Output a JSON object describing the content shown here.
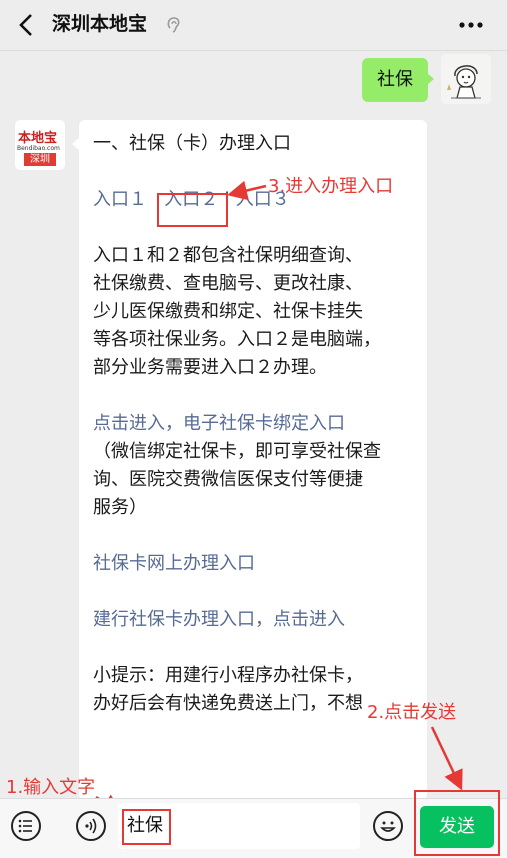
{
  "header": {
    "title": "深圳本地宝"
  },
  "outgoing": {
    "text": "社保"
  },
  "bot_avatar": {
    "logo": "本地宝",
    "site": "Bendibao.com",
    "city": "深圳"
  },
  "message": {
    "heading": "一、社保（卡）办理入口",
    "entry1": "入口１",
    "entry2": "入口２",
    "separator": "|",
    "entry3": "入口３",
    "desc_lines": [
      "入口１和２都包含社保明细查询、",
      "社保缴费、查电脑号、更改社康、",
      "少儿医保缴费和绑定、社保卡挂失",
      "等各项社保业务。入口２是电脑端，",
      "部分业务需要进入口２办理。"
    ],
    "ecard_link": "点击进入，电子社保卡绑定入口",
    "ecard_note_lines": [
      "（微信绑定社保卡，即可享受社保查",
      "询、医院交费微信医保支付等便捷",
      "服务）"
    ],
    "online_link": "社保卡网上办理入口",
    "ccb_link": "建行社保卡办理入口，点击进入",
    "tip_lines": [
      "小提示：用建行小程序办社保卡，",
      "办好后会有快递免费送上门，不想"
    ]
  },
  "annotations": {
    "step1": "1.输入文字",
    "step2": "2.点击发送",
    "step3": "3.进入办理入口"
  },
  "input": {
    "value": "社保",
    "send_label": "发送"
  },
  "colors": {
    "link": "#576b95",
    "annotation": "#e53935",
    "send_button": "#07c160",
    "outgoing_bubble": "#95ec69"
  }
}
